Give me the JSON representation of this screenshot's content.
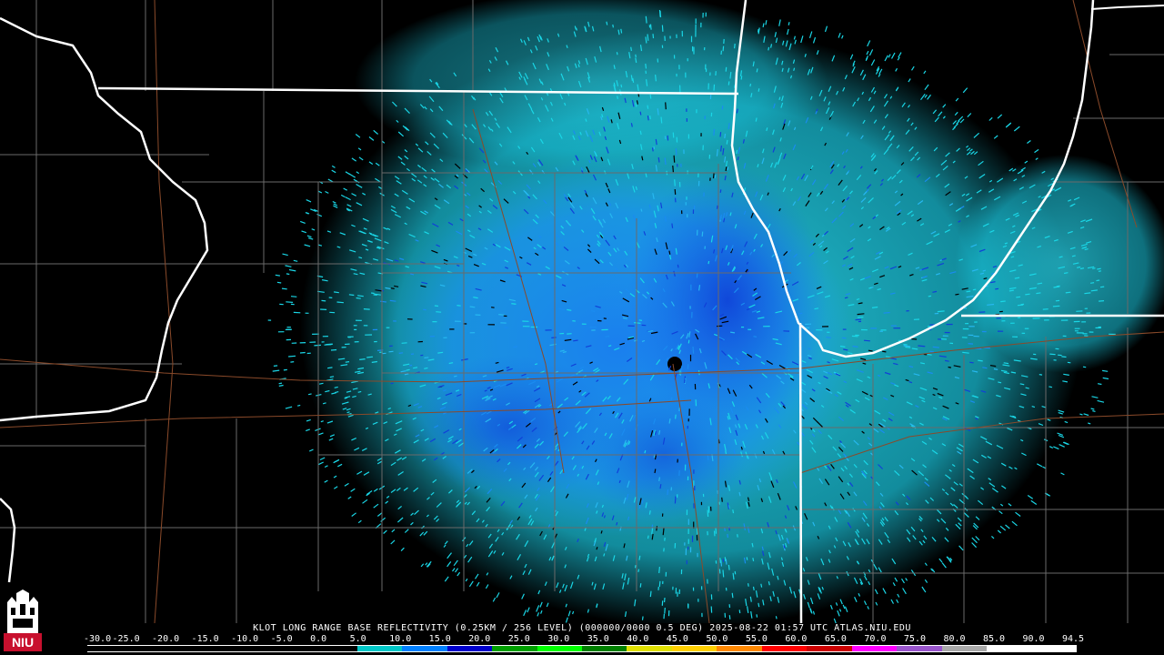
{
  "caption": "KLOT LONG RANGE BASE REFLECTIVITY (0.25KM / 256 LEVEL) (000000/0000 0.5 DEG) 2025-08-22 01:57 UTC  ATLAS.NIU.EDU",
  "scale": {
    "labels": [
      "-30.0",
      "-25.0",
      "-20.0",
      "-15.0",
      "-10.0",
      "-5.0",
      "0.0",
      "5.0",
      "10.0",
      "15.0",
      "20.0",
      "25.0",
      "30.0",
      "35.0",
      "40.0",
      "45.0",
      "50.0",
      "55.0",
      "60.0",
      "65.0",
      "70.0",
      "75.0",
      "80.0",
      "85.0",
      "90.0",
      "94.5"
    ],
    "colors": [
      "#000000",
      "#000000",
      "#000000",
      "#000000",
      "#000000",
      "#000000",
      "#00c8c8",
      "#0080ff",
      "#0000cc",
      "#00a000",
      "#00ff00",
      "#008000",
      "#e0e000",
      "#ffd000",
      "#ff8800",
      "#ff0000",
      "#cc0000",
      "#ff00ff",
      "#9955cc",
      "#aaaaaa",
      "#ffffff",
      "#ffffff"
    ]
  },
  "colors": {
    "background": "#000000",
    "state_border": "#ffffff",
    "county_line": "#6a6a6a",
    "road_line": "#8a4a2a",
    "echo_light": "#1ad6e6",
    "echo_mid": "#1a8cf0",
    "echo_strong": "#1040d8",
    "echo_peak": "#22c022"
  },
  "logo": {
    "text": "NIU"
  }
}
